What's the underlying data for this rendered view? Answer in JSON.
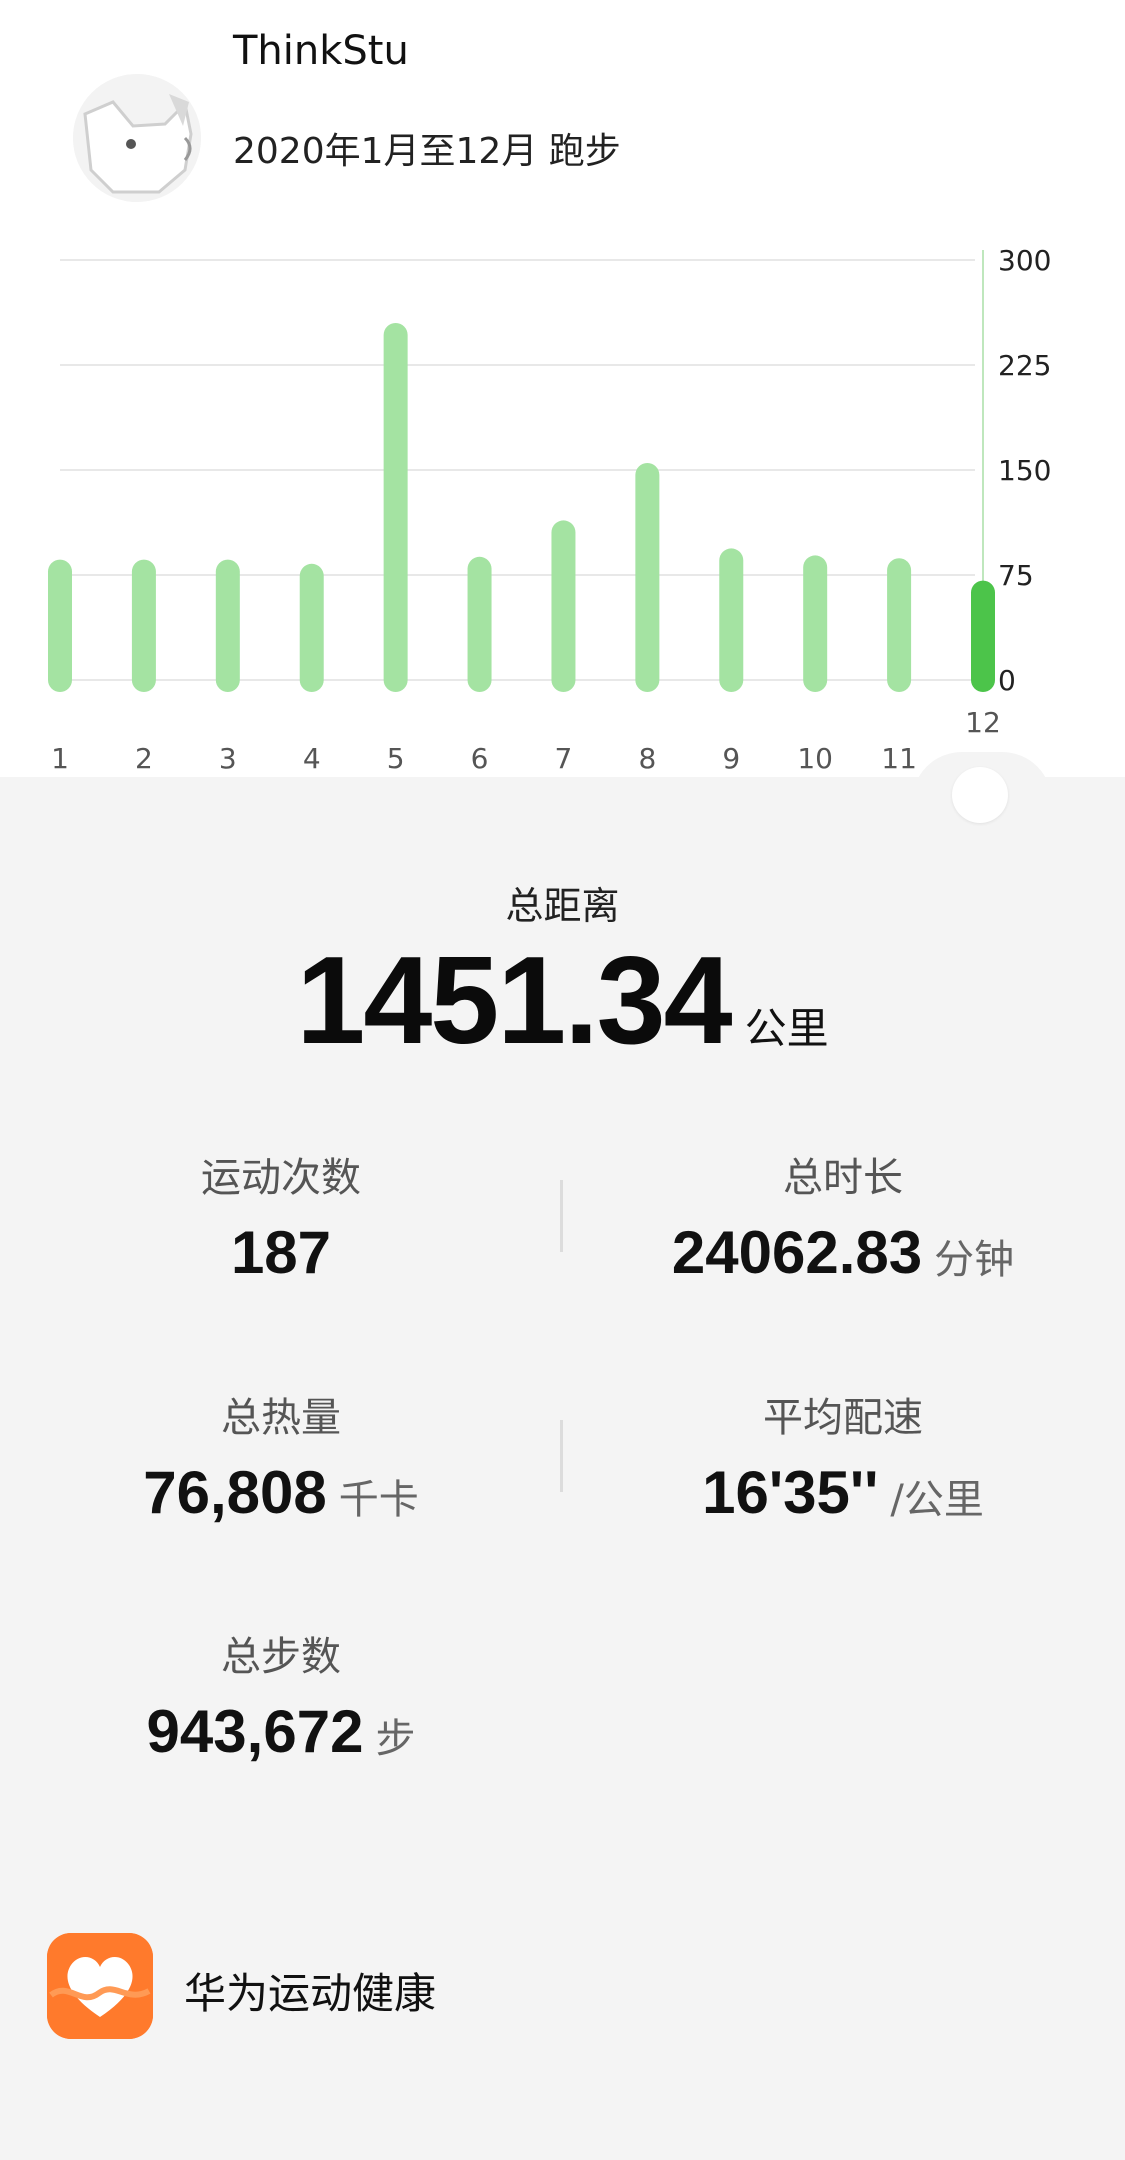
{
  "header": {
    "user_name": "ThinkStu",
    "subtitle": "2020年1月至12月 跑步"
  },
  "chart_data": {
    "type": "bar",
    "categories": [
      "1",
      "2",
      "3",
      "4",
      "5",
      "6",
      "7",
      "8",
      "9",
      "10",
      "11",
      "12"
    ],
    "values": [
      86,
      86,
      86,
      83,
      255,
      88,
      114,
      155,
      94,
      89,
      87,
      71
    ],
    "selected_index": 11,
    "ylim": [
      0,
      300
    ],
    "yticks": [
      "300",
      "225",
      "150",
      "75",
      "0"
    ],
    "grid": true,
    "colors": {
      "bar": "#a4e3a2",
      "selected_bar": "#4cc44a"
    }
  },
  "summary": {
    "total_distance_label": "总距离",
    "total_distance_value": "1451.34",
    "total_distance_unit": "公里"
  },
  "stats": {
    "workouts_label": "运动次数",
    "workouts_value": "187",
    "duration_label": "总时长",
    "duration_value": "24062.83",
    "duration_unit": "分钟",
    "calories_label": "总热量",
    "calories_value": "76,808",
    "calories_unit": "千卡",
    "pace_label": "平均配速",
    "pace_value": "16'35''",
    "pace_unit": "/公里",
    "steps_label": "总步数",
    "steps_value": "943,672",
    "steps_unit": "步"
  },
  "footer": {
    "app_name": "华为运动健康",
    "app_icon": "heart-icon",
    "accent": "#ff7a2c"
  }
}
